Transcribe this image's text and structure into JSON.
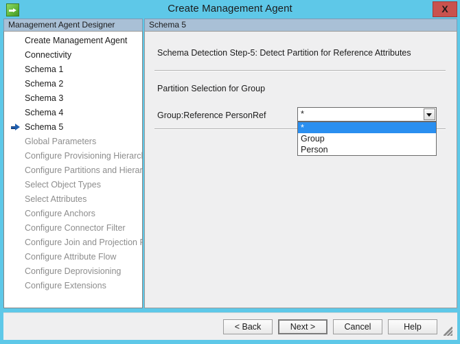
{
  "window": {
    "title": "Create Management Agent",
    "app_icon": "green-arrow-icon",
    "close_label": "X",
    "titlebar_color": "#5ec8e8",
    "close_button_color": "#c9524e"
  },
  "sidebar": {
    "header": "Management Agent Designer",
    "items": [
      {
        "label": "Create Management Agent",
        "enabled": true,
        "current": false
      },
      {
        "label": "Connectivity",
        "enabled": true,
        "current": false
      },
      {
        "label": "Schema 1",
        "enabled": true,
        "current": false
      },
      {
        "label": "Schema 2",
        "enabled": true,
        "current": false
      },
      {
        "label": "Schema 3",
        "enabled": true,
        "current": false
      },
      {
        "label": "Schema 4",
        "enabled": true,
        "current": false
      },
      {
        "label": "Schema 5",
        "enabled": true,
        "current": true
      },
      {
        "label": "Global Parameters",
        "enabled": false,
        "current": false
      },
      {
        "label": "Configure Provisioning Hierarchy",
        "enabled": false,
        "current": false
      },
      {
        "label": "Configure Partitions and Hierarchies",
        "enabled": false,
        "current": false
      },
      {
        "label": "Select Object Types",
        "enabled": false,
        "current": false
      },
      {
        "label": "Select Attributes",
        "enabled": false,
        "current": false
      },
      {
        "label": "Configure Anchors",
        "enabled": false,
        "current": false
      },
      {
        "label": "Configure Connector Filter",
        "enabled": false,
        "current": false
      },
      {
        "label": "Configure Join and Projection Rules",
        "enabled": false,
        "current": false
      },
      {
        "label": "Configure Attribute Flow",
        "enabled": false,
        "current": false
      },
      {
        "label": "Configure Deprovisioning",
        "enabled": false,
        "current": false
      },
      {
        "label": "Configure Extensions",
        "enabled": false,
        "current": false
      }
    ]
  },
  "content": {
    "header": "Schema 5",
    "step_title": "Schema Detection Step-5: Detect Partition for Reference Attributes",
    "section_label": "Partition Selection for Group",
    "field_label": "Group:Reference PersonRef",
    "combo": {
      "value": "*",
      "arrow_icon": "chevron-down-icon",
      "expanded": true,
      "options": [
        {
          "label": "*",
          "selected": true
        },
        {
          "label": "Group",
          "selected": false
        },
        {
          "label": "Person",
          "selected": false
        }
      ],
      "highlight_color": "#2a8ff0"
    }
  },
  "footer": {
    "back_label": "< Back",
    "next_label": "Next >",
    "cancel_label": "Cancel",
    "help_label": "Help"
  }
}
